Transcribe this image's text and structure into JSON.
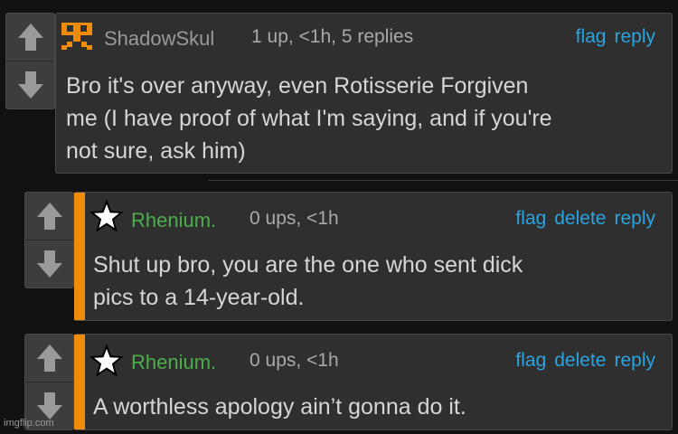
{
  "comments": [
    {
      "username": "ShadowSkul",
      "user_color": "#9a9a9a",
      "info": "1 up, <1h, 5 replies",
      "actions": [
        "flag",
        "reply"
      ],
      "text_lines": [
        "Bro it's over anyway, even Rotisserie Forgiven",
        "me (I have proof of what I'm saying, and if you're",
        "not sure, ask him)"
      ],
      "avatar": "orange-skull-icon"
    },
    {
      "username": "Rhenium.",
      "user_color": "#4cae4c",
      "info": "0 ups, <1h",
      "actions": [
        "flag",
        "delete",
        "reply"
      ],
      "text_lines": [
        "Shut up bro, you are the one who sent dick",
        "pics to a 14-year-old."
      ],
      "avatar": "star-icon"
    },
    {
      "username": "Rhenium.",
      "user_color": "#4cae4c",
      "info": "0 ups, <1h",
      "actions": [
        "flag",
        "delete",
        "reply"
      ],
      "text_lines": [
        "A worthless apology ain’t gonna do it."
      ],
      "avatar": "star-icon"
    }
  ],
  "watermark": "imgflip.com",
  "colors": {
    "link": "#2aa3df",
    "op_bar": "#f08c0c",
    "background": "#111111"
  }
}
